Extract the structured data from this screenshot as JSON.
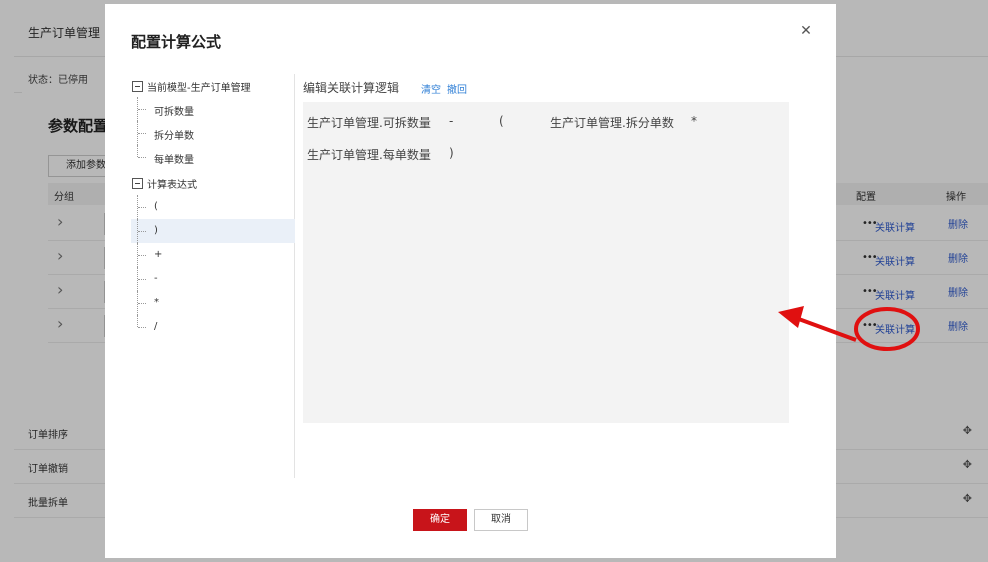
{
  "background": {
    "page_title": "生产订单管理",
    "status": "状态：已停用",
    "param_modal": {
      "title": "参数配置",
      "add_button": "添加参数",
      "headers": {
        "group": "分组",
        "config": "配置",
        "operation": "操作"
      },
      "rows": [
        {
          "link": "关联计算",
          "delete": "删除"
        },
        {
          "link": "关联计算",
          "delete": "删除"
        },
        {
          "link": "关联计算",
          "delete": "删除"
        },
        {
          "link": "关联计算",
          "delete": "删除"
        }
      ]
    },
    "list_rows": [
      {
        "label": "订单排序"
      },
      {
        "label": "订单撤销"
      },
      {
        "label": "批量拆单"
      }
    ]
  },
  "modal": {
    "title": "配置计算公式",
    "tree": {
      "groups": [
        {
          "label": "当前模型-生产订单管理",
          "items": [
            "可拆数量",
            "拆分单数",
            "每单数量"
          ]
        },
        {
          "label": "计算表达式",
          "items": [
            "(",
            ")",
            "+",
            "-",
            "*",
            "/"
          ]
        }
      ]
    },
    "editor": {
      "title": "编辑关联计算逻辑",
      "clear_label": "清空",
      "undo_label": "撤回",
      "formula": {
        "line1": [
          "生产订单管理.可拆数量",
          "-",
          "(",
          "生产订单管理.拆分单数",
          "*"
        ],
        "line2": [
          "生产订单管理.每单数量",
          ")"
        ]
      }
    },
    "confirm_label": "确定",
    "cancel_label": "取消"
  },
  "colors": {
    "primary_red": "#c8141a",
    "link_blue": "#2f7fd6",
    "annotation_red": "#e01010"
  }
}
